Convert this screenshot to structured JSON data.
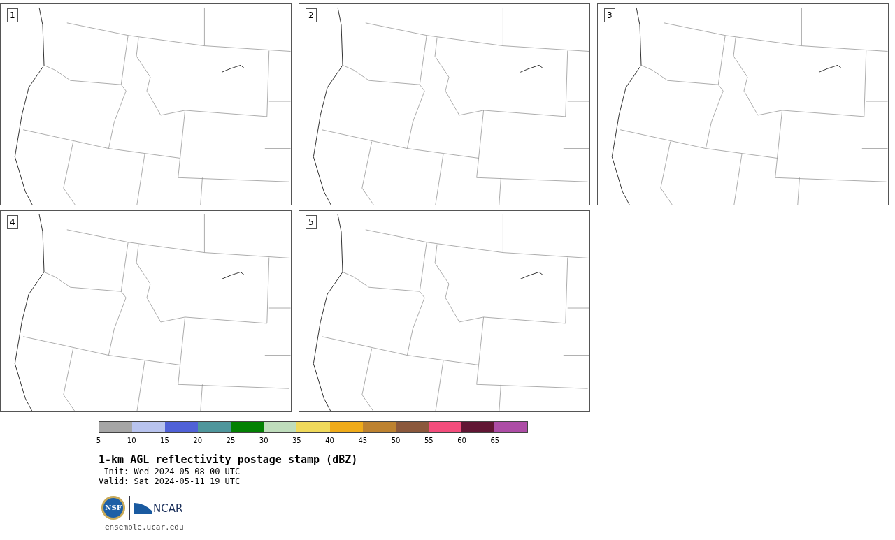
{
  "panels": [
    {
      "label": "1"
    },
    {
      "label": "2"
    },
    {
      "label": "3"
    },
    {
      "label": "4"
    },
    {
      "label": "5"
    }
  ],
  "colorbar": {
    "segments": [
      {
        "color": "#a6a6a6"
      },
      {
        "color": "#b8c3ee"
      },
      {
        "color": "#5061d7"
      },
      {
        "color": "#4f969c"
      },
      {
        "color": "#038103"
      },
      {
        "color": "#bfddbc"
      },
      {
        "color": "#efd95b"
      },
      {
        "color": "#efab1a"
      },
      {
        "color": "#bd8230"
      },
      {
        "color": "#8b583c"
      },
      {
        "color": "#f34d7c"
      },
      {
        "color": "#611634"
      },
      {
        "color": "#ad4da6"
      }
    ],
    "ticks": [
      "5",
      "10",
      "15",
      "20",
      "25",
      "30",
      "35",
      "40",
      "45",
      "50",
      "55",
      "60",
      "65"
    ]
  },
  "title": "1-km AGL reflectivity postage stamp (dBZ)",
  "init": " Init: Wed 2024-05-08 00 UTC",
  "valid": "Valid: Sat 2024-05-11 19 UTC",
  "logos": {
    "nsf": "NSF",
    "ncar": "NCAR"
  },
  "url": "ensemble.ucar.edu"
}
